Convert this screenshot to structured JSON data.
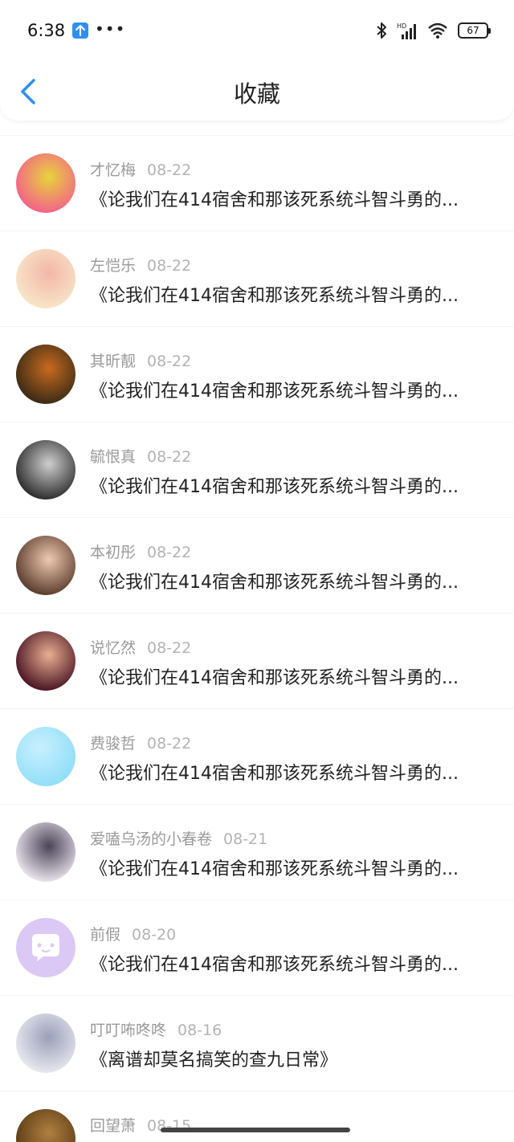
{
  "status_bar": {
    "time": "6:38",
    "extra": "•••",
    "battery": "67"
  },
  "nav": {
    "title": "收藏"
  },
  "items": [
    {
      "author": "才忆梅",
      "date": "08-22",
      "title": "《论我们在414宿舍和那该死系统斗智斗勇的...",
      "avatar": "patrick-spongebob",
      "avatar_colors": [
        "#f2628a",
        "#e8d33b"
      ]
    },
    {
      "author": "左恺乐",
      "date": "08-22",
      "title": "《论我们在414宿舍和那该死系统斗智斗勇的...",
      "avatar": "anime-girl",
      "avatar_colors": [
        "#f7e6c8",
        "#f4b6a8"
      ]
    },
    {
      "author": "其昕靓",
      "date": "08-22",
      "title": "《论我们在414宿舍和那该死系统斗智斗勇的...",
      "avatar": "fish-tank",
      "avatar_colors": [
        "#3a2b16",
        "#c96a1e"
      ]
    },
    {
      "author": "毓恨真",
      "date": "08-22",
      "title": "《论我们在414宿舍和那该死系统斗智斗勇的...",
      "avatar": "bw-portrait",
      "avatar_colors": [
        "#2d2d2d",
        "#cfcfcf"
      ]
    },
    {
      "author": "本初彤",
      "date": "08-22",
      "title": "《论我们在414宿舍和那该死系统斗智斗勇的...",
      "avatar": "girl-selfie",
      "avatar_colors": [
        "#5a3c2c",
        "#f0c8b0"
      ]
    },
    {
      "author": "说忆然",
      "date": "08-22",
      "title": "《论我们在414宿舍和那该死系统斗智斗勇的...",
      "avatar": "child-portrait",
      "avatar_colors": [
        "#4a1424",
        "#e8b090"
      ]
    },
    {
      "author": "费骏哲",
      "date": "08-22",
      "title": "《论我们在414宿舍和那该死系统斗智斗勇的...",
      "avatar": "default-blue",
      "avatar_colors": [
        "#7fd8f5",
        "#c8f0ff"
      ]
    },
    {
      "author": "爱嗑乌汤的小春卷",
      "date": "08-21",
      "title": "《论我们在414宿舍和那该死系统斗智斗勇的...",
      "avatar": "anime-pair",
      "avatar_colors": [
        "#e9e4ec",
        "#4a4458"
      ]
    },
    {
      "author": "前假",
      "date": "08-20",
      "title": "《论我们在414宿舍和那该死系统斗智斗勇的...",
      "avatar": "default-chat",
      "avatar_colors": [
        "#dcc8f5",
        "#ffffff"
      ]
    },
    {
      "author": "叮叮咘咚咚",
      "date": "08-16",
      "title": "《离谱却莫名搞笑的查九日常》",
      "avatar": "anime-white-hair",
      "avatar_colors": [
        "#e8e8f0",
        "#9aa0b8"
      ]
    },
    {
      "author": "回望萧",
      "date": "08-15",
      "title": "",
      "avatar": "partial",
      "avatar_colors": [
        "#5a3a14",
        "#b08040"
      ]
    }
  ],
  "colors": {
    "accent": "#2f8ff3",
    "author_text": "#9a9a9a",
    "title_text": "#222222"
  }
}
